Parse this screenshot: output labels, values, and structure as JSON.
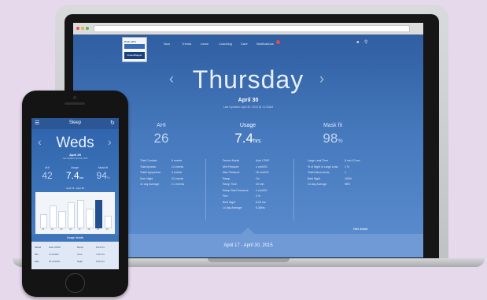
{
  "laptop": {
    "nav": {
      "items": [
        "Now",
        "Trends",
        "Learn",
        "Coaching",
        "Care",
        "Notifications"
      ],
      "logo_brand": "PHILIPS",
      "logo_sub": "RESPIRONICS",
      "logo_product": "DreamMapper",
      "icons": [
        "user-icon",
        "search-icon"
      ]
    },
    "day": "Thursday",
    "date": "April 30",
    "updated": "Last Updated: April 30, 2015 @ 11:03AM",
    "metrics": [
      {
        "label": "AHI",
        "value": "26",
        "unit": ""
      },
      {
        "label": "Usage",
        "value": "7.4",
        "unit": "hrs"
      },
      {
        "label": "Mask fit",
        "value": "98",
        "unit": "%"
      }
    ],
    "table_left": [
      [
        "Total Centrals",
        "6 events"
      ],
      [
        "Total Apneas",
        "12 events"
      ],
      [
        "Total Hypopneas",
        "3 events"
      ],
      [
        "Sum Night",
        "21 events"
      ],
      [
        "14 day Average",
        "2.4 events"
      ]
    ],
    "table_mid": [
      [
        "Device Model",
        "Auto CPAP"
      ],
      [
        "Min Pressure",
        "4 cmH2O"
      ],
      [
        "Max Pressure",
        "15 cmH2O"
      ],
      [
        "Ramp",
        "On"
      ],
      [
        "Ramp Time",
        "30 min"
      ],
      [
        "Ramp Start Pressure",
        "4 cmH2O"
      ],
      [
        "Flex",
        "4 %"
      ],
      [
        "Best Night",
        "8.00 hrs"
      ],
      [
        "14 day Average",
        "6.38hrs"
      ]
    ],
    "table_right": [
      [
        "Large Leak Time",
        "8 min 12 sec"
      ],
      [
        "% of Night in Large Leak",
        "1 %"
      ],
      [
        "Total Disconnects",
        "1"
      ],
      [
        "Best Night",
        "100%"
      ],
      [
        "14 day Average",
        "98%"
      ]
    ],
    "hide_details": "Hide details",
    "range": "April 17 - April 30, 2015"
  },
  "phone": {
    "title": "Sleep",
    "day": "Weds",
    "date": "April 29",
    "updated": "Last Updated: April 29, 2015",
    "metrics": [
      {
        "label": "AHI",
        "value": "42",
        "unit": ""
      },
      {
        "label": "Usage",
        "value": "7.4",
        "unit": "hrs"
      },
      {
        "label": "Mask fit",
        "value": "94",
        "unit": "%"
      }
    ],
    "range": "April 16 - April 30",
    "bar_labels": [
      "23",
      "24",
      "25",
      "26",
      "27",
      "28",
      "29",
      "30"
    ],
    "bars": [
      0.45,
      0.75,
      0.55,
      0.85,
      0.95,
      0.65,
      0.95,
      0.4
    ],
    "selected_bar": 6,
    "details_title": "Usage details",
    "details": [
      [
        "Model",
        "Auto CPAP",
        "Ramp",
        "8.44 hrs"
      ],
      [
        "Min",
        "4 cmH2O",
        "Time",
        "7.22 hrs"
      ],
      [
        "Max",
        "15 cmH2O",
        "Night",
        "5.26 hrs"
      ]
    ]
  }
}
